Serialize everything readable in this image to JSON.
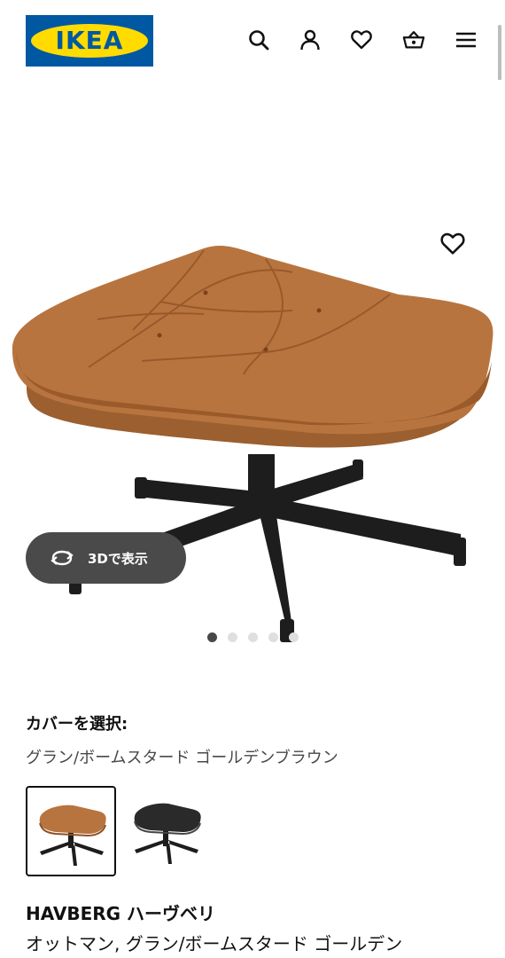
{
  "header": {
    "logo_text": "IKEA",
    "icons": [
      "search-icon",
      "account-icon",
      "heart-icon",
      "basket-icon",
      "menu-icon"
    ]
  },
  "gallery": {
    "favorite_icon": "heart-icon",
    "view3d_label": "3Dで表示",
    "dots_total": 5,
    "dot_active_index": 0
  },
  "cover": {
    "label": "カバーを選択:",
    "value": "グラン/ボームスタード ゴールデンブラウン",
    "swatches": [
      {
        "color": "#b8743f",
        "selected": true
      },
      {
        "color": "#2a2a2a",
        "selected": false
      }
    ]
  },
  "product": {
    "name": "HAVBERG ハーヴベリ",
    "description": "オットマン, グラン/ボームスタード ゴールデン"
  },
  "colors": {
    "ikea_blue": "#0058a3",
    "ikea_yellow": "#ffdb00",
    "leather": "#b8743f",
    "button_bg": "#4a4a4a"
  }
}
